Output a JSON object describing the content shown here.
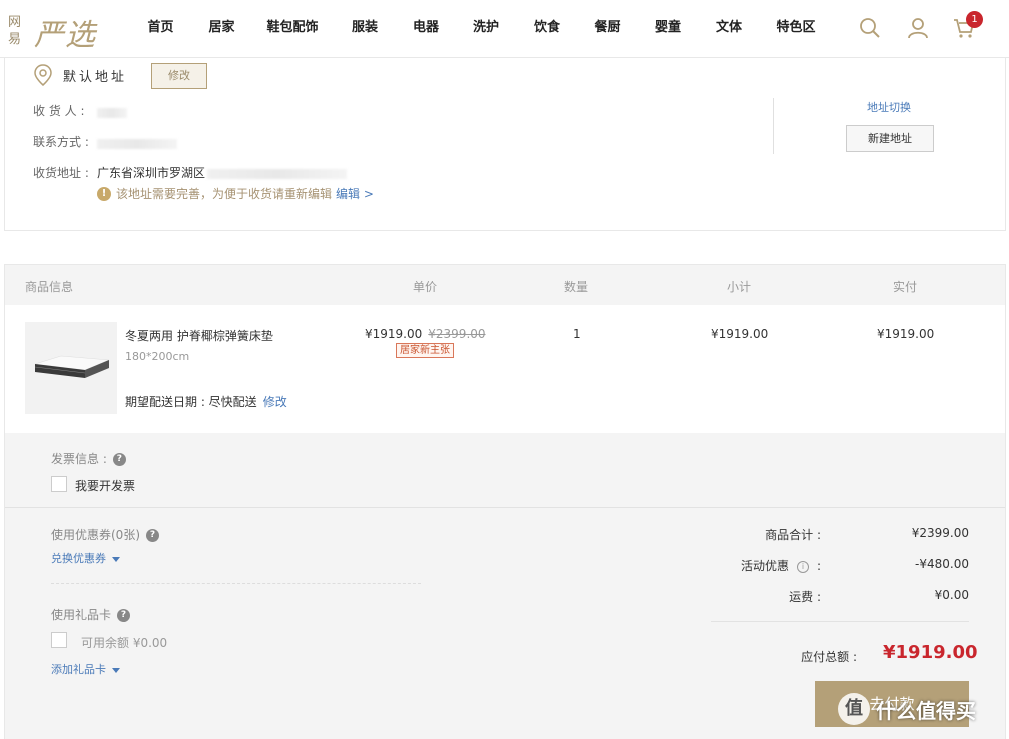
{
  "header": {
    "logo_small": "网易",
    "logo_main": "严选",
    "nav": [
      "首页",
      "居家",
      "鞋包配饰",
      "服装",
      "电器",
      "洗护",
      "饮食",
      "餐厨",
      "婴童",
      "文体",
      "特色区"
    ],
    "cart_count": "1",
    "icons": [
      "search-icon",
      "user-icon",
      "cart-icon"
    ]
  },
  "address": {
    "title": "默认地址",
    "edit_label": "修改",
    "receiver_label": "收 货 人 :",
    "contact_label": "联系方式 :",
    "address_label": "收货地址 :",
    "address_value": "广东省深圳市罗湖区",
    "warning_text": "该地址需要完善，为便于收货请重新编辑",
    "warning_link": "编辑 >",
    "switch_label": "地址切换",
    "new_label": "新建地址"
  },
  "order": {
    "headers": {
      "info": "商品信息",
      "unit_price": "单价",
      "quantity": "数量",
      "subtotal": "小计",
      "paid": "实付"
    },
    "item": {
      "name": "冬夏两用 护脊椰棕弹簧床垫",
      "spec": "180*200cm",
      "delivery_label": "期望配送日期 :  尽快配送",
      "delivery_edit": "修改",
      "price": "¥1919.00",
      "orig_price": "¥2399.00",
      "promo_tag": "居家新主张",
      "quantity": "1",
      "subtotal": "¥1919.00",
      "paid": "¥1919.00"
    },
    "invoice": {
      "label": "发票信息 :",
      "checkbox_label": "我要开发票"
    },
    "coupon": {
      "label": "使用优惠券(0张)",
      "redeem_link": "兑换优惠券"
    },
    "giftcard": {
      "label": "使用礼品卡",
      "balance_label": "可用余额 ¥0.00",
      "add_link": "添加礼品卡"
    },
    "summary": {
      "goods_total_label": "商品合计  :",
      "goods_total": "¥2399.00",
      "discount_label": "活动优惠",
      "discount_colon": ":",
      "discount": "-¥480.00",
      "shipping_label": "运费  :",
      "shipping": "¥0.00",
      "payable_label": "应付总额  :",
      "payable": "¥1919.00",
      "pay_button": "去付款"
    }
  },
  "watermark": {
    "badge": "值",
    "text": "什么值得买"
  }
}
